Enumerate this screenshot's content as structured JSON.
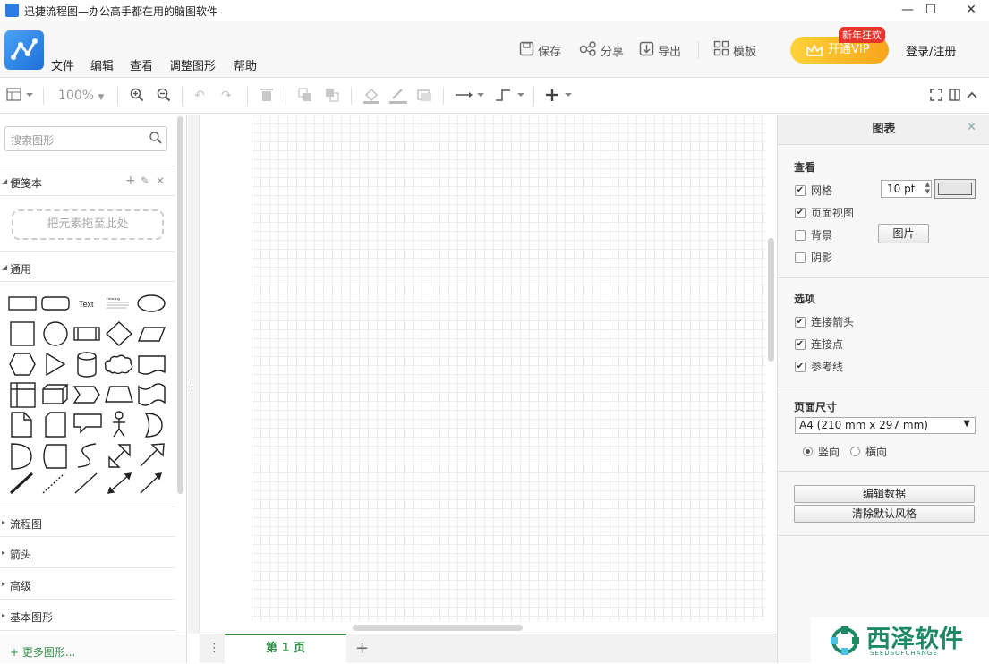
{
  "window": {
    "title": "迅捷流程图—办公高手都在用的脑图软件",
    "controls": [
      "—",
      "☐",
      "✕"
    ]
  },
  "menu": [
    "文件",
    "编辑",
    "查看",
    "调整图形",
    "帮助"
  ],
  "header_actions": {
    "save": "保存",
    "share": "分享",
    "export": "导出",
    "templates": "模板",
    "vip": "开通VIP",
    "vip_badge": "新年狂欢",
    "login": "登录/注册"
  },
  "toolbar": {
    "zoom": "100%"
  },
  "left_panel": {
    "search_placeholder": "搜索图形",
    "scratchpad": "便笺本",
    "dropzone": "把元素拖至此处",
    "general": "通用",
    "shape_text": "Text",
    "shape_heading": "Heading",
    "sections": [
      "流程图",
      "箭头",
      "高级",
      "基本图形"
    ],
    "more_shapes": "+ 更多图形..."
  },
  "page_tab": "第 1 页",
  "right_panel": {
    "title": "图表",
    "view_head": "查看",
    "grid": "网格",
    "grid_size": "10 pt",
    "page_view": "页面视图",
    "background": "背景",
    "image_btn": "图片",
    "shadow": "阴影",
    "options_head": "选项",
    "connection_arrows": "连接箭头",
    "connection_points": "连接点",
    "guides": "参考线",
    "page_size_head": "页面尺寸",
    "page_size": "A4 (210 mm x 297 mm)",
    "portrait": "竖向",
    "landscape": "横向",
    "edit_data": "编辑数据",
    "clear_style": "清除默认风格",
    "checked": {
      "grid": true,
      "page_view": true,
      "background": false,
      "shadow": false,
      "connection_arrows": true,
      "connection_points": true,
      "guides": true
    }
  },
  "watermark": {
    "text": "西泽软件",
    "sub": "SEEDSOFCHANGE"
  }
}
